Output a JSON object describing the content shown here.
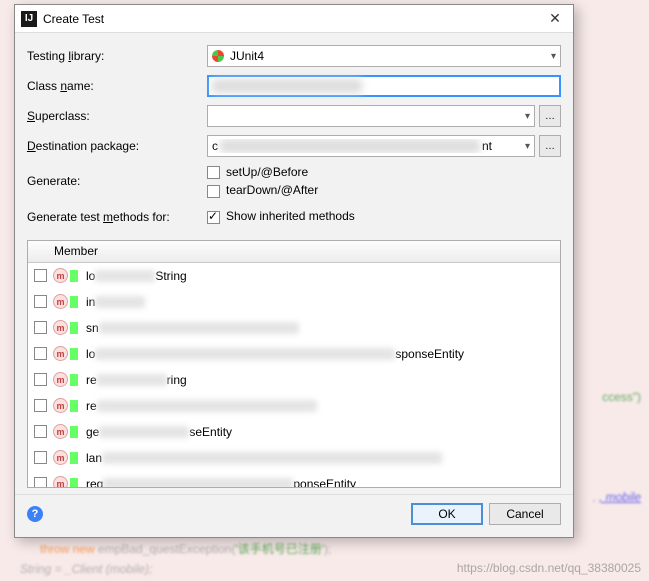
{
  "titlebar": {
    "title": "Create Test"
  },
  "labels": {
    "testingLibrary": {
      "pre": "Testing ",
      "u": "l",
      "post": "ibrary:"
    },
    "className": {
      "pre": "Class ",
      "u": "n",
      "post": "ame:"
    },
    "superclass": {
      "u": "S",
      "post": "uperclass:"
    },
    "destination": {
      "u": "D",
      "post": "estination package:"
    },
    "generate": "Generate:",
    "genMethods": {
      "pre": "Generate test ",
      "u": "m",
      "post": "ethods for:"
    }
  },
  "testingLibrary": {
    "selected": "JUnit4"
  },
  "classNameValue": "________________Tests",
  "superclassValue": "",
  "destValue_pre": "c",
  "destValue_blur": "om.example.something.package.pla",
  "destValue_post": "nt",
  "generateOpts": {
    "setUp": {
      "label": "setUp/@Before",
      "checked": false
    },
    "tearDown": {
      "label": "tearDown/@After",
      "checked": false
    }
  },
  "showInherited": {
    "label": "Show inherited methods",
    "checked": true
  },
  "memberHeader": "Member",
  "members": {
    "items": [
      {
        "p0": "lo",
        "blur1": 60,
        "p1": "String"
      },
      {
        "p0": "in",
        "blur1": 50,
        "p1": ""
      },
      {
        "p0": "sn",
        "blur1": 200,
        "p1": ""
      },
      {
        "p0": "lo",
        "blur1": 300,
        "p1": "sponseEntity"
      },
      {
        "p0": "re",
        "blur1": 70,
        "p1": "ring"
      },
      {
        "p0": "re",
        "blur1": 220,
        "p1": ""
      },
      {
        "p0": "ge",
        "blur1": 90,
        "p1": "seEntity"
      },
      {
        "p0": "lan",
        "blur1": 340,
        "p1": ""
      },
      {
        "p0": "reg",
        "blur1": 190,
        "p1": "ponseEntity"
      }
    ]
  },
  "buttons": {
    "ok": "OK",
    "cancel": "Cancel"
  },
  "watermark": "https://blog.csdn.net/qq_38380025",
  "bg": {
    "l1a": "throw new",
    "l1b": " empBad_questException(",
    "l1c": "'该手机号已注册'",
    "l1d": ");",
    "l2a": "String    = _Client       (mobile);",
    "r1": "ccess\")",
    "r2": ", mobile"
  }
}
